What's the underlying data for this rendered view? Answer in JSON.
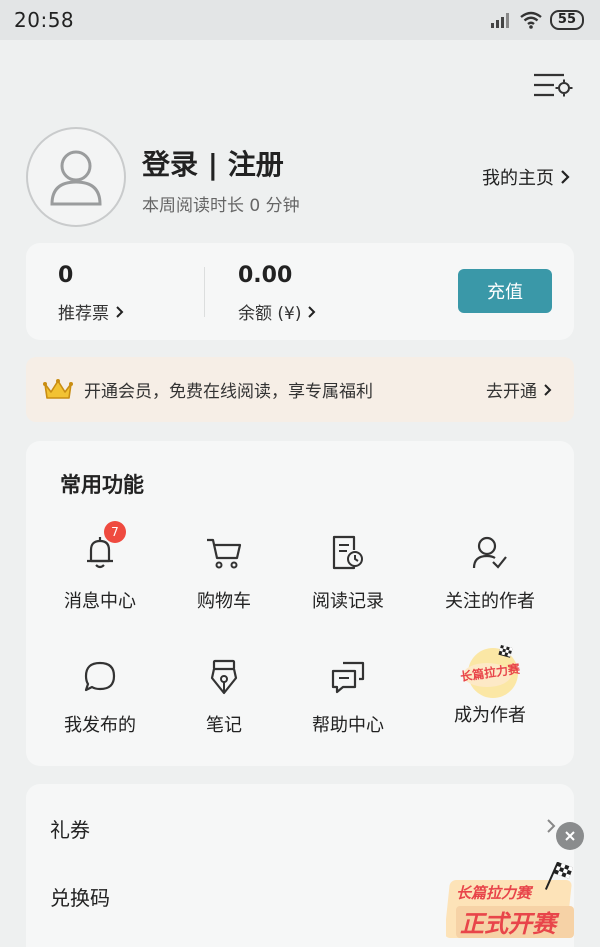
{
  "status_bar": {
    "time": "20:58",
    "battery": "55"
  },
  "profile": {
    "login_label": "登录 | 注册",
    "weekly_reading": "本周阅读时长 0 分钟",
    "homepage_label": "我的主页"
  },
  "wallet": {
    "tickets_value": "0",
    "tickets_label": "推荐票",
    "balance_value": "0.00",
    "balance_label": "余额 (¥)",
    "recharge_label": "充值"
  },
  "vip": {
    "text": "开通会员，免费在线阅读，享专属福利",
    "action": "去开通"
  },
  "functions": {
    "title": "常用功能",
    "items": [
      {
        "label": "消息中心",
        "icon": "bell-icon",
        "badge": "7"
      },
      {
        "label": "购物车",
        "icon": "cart-icon"
      },
      {
        "label": "阅读记录",
        "icon": "reading-history-icon"
      },
      {
        "label": "关注的作者",
        "icon": "followed-author-icon"
      },
      {
        "label": "我发布的",
        "icon": "chat-bubble-icon"
      },
      {
        "label": "笔记",
        "icon": "pen-nib-icon"
      },
      {
        "label": "帮助中心",
        "icon": "help-chat-icon"
      },
      {
        "label": "成为作者",
        "icon": "writer-contest-logo",
        "logo_text": "长篇拉力赛"
      }
    ]
  },
  "menu": {
    "items": [
      {
        "label": "礼券"
      },
      {
        "label": "兑换码"
      }
    ]
  },
  "promo": {
    "line1": "长篇拉力赛",
    "line2": "正式开赛"
  },
  "colors": {
    "accent": "#3a98a8",
    "badge": "#ef4a3f",
    "vip_bg": "#f6eee6"
  }
}
